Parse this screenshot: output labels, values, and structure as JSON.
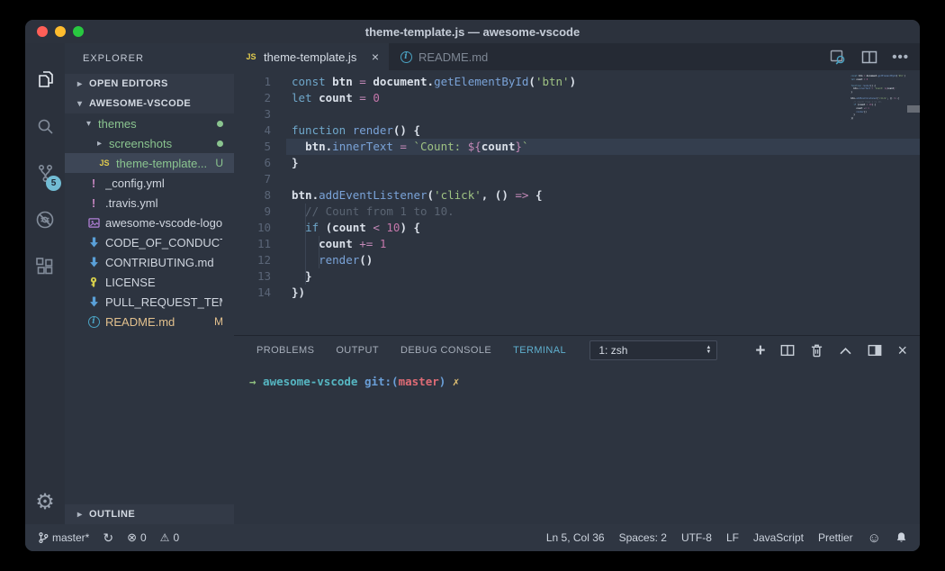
{
  "window": {
    "title": "theme-template.js — awesome-vscode"
  },
  "activity_bar": {
    "items": [
      "explorer",
      "search",
      "source-control",
      "debug",
      "extensions"
    ],
    "active": "explorer",
    "scm_badge": "5"
  },
  "sidebar": {
    "header": "EXPLORER",
    "sections": {
      "open_editors": "OPEN EDITORS",
      "root": "AWESOME-VSCODE",
      "outline": "OUTLINE"
    },
    "tree": [
      {
        "type": "folder",
        "label": "themes",
        "expanded": true,
        "color": "green",
        "badge": "dot",
        "indent": 1
      },
      {
        "type": "folder",
        "label": "screenshots",
        "expanded": false,
        "color": "green",
        "badge": "dot",
        "indent": 2
      },
      {
        "type": "file",
        "icon": "js",
        "label": "theme-template....",
        "color": "green",
        "badge": "U",
        "selected": true,
        "indent": 2
      },
      {
        "type": "file",
        "icon": "yaml",
        "label": "_config.yml",
        "indent": 1
      },
      {
        "type": "file",
        "icon": "yaml",
        "label": ".travis.yml",
        "indent": 1
      },
      {
        "type": "file",
        "icon": "image",
        "label": "awesome-vscode-logo...",
        "indent": 1
      },
      {
        "type": "file",
        "icon": "markdown",
        "label": "CODE_OF_CONDUCT....",
        "indent": 1
      },
      {
        "type": "file",
        "icon": "markdown",
        "label": "CONTRIBUTING.md",
        "indent": 1
      },
      {
        "type": "file",
        "icon": "key",
        "label": "LICENSE",
        "indent": 1
      },
      {
        "type": "file",
        "icon": "markdown",
        "label": "PULL_REQUEST_TEMP...",
        "indent": 1
      },
      {
        "type": "file",
        "icon": "info",
        "label": "README.md",
        "color": "orange",
        "badge": "M",
        "indent": 1
      }
    ]
  },
  "editor": {
    "tabs": [
      {
        "icon": "js",
        "label": "theme-template.js",
        "close": "×",
        "active": true
      },
      {
        "icon": "info",
        "label": "README.md",
        "active": false
      }
    ],
    "current_line": 5,
    "lines": [
      [
        [
          "k",
          "const "
        ],
        [
          "v",
          "btn"
        ],
        [
          "o",
          " = "
        ],
        [
          "v",
          "document"
        ],
        [
          "p",
          "."
        ],
        [
          "f",
          "getElementById"
        ],
        [
          "p",
          "("
        ],
        [
          "s",
          "'btn'"
        ],
        [
          "p",
          ")"
        ]
      ],
      [
        [
          "k",
          "let "
        ],
        [
          "v",
          "count"
        ],
        [
          "o",
          " = "
        ],
        [
          "n",
          "0"
        ]
      ],
      [],
      [
        [
          "k",
          "function "
        ],
        [
          "f",
          "render"
        ],
        [
          "p",
          "() {"
        ]
      ],
      [
        [
          "p",
          "  "
        ],
        [
          "v",
          "btn"
        ],
        [
          "p",
          "."
        ],
        [
          "f",
          "innerText"
        ],
        [
          "o",
          " = "
        ],
        [
          "s",
          "`Count: "
        ],
        [
          "o",
          "${"
        ],
        [
          "v",
          "count"
        ],
        [
          "o",
          "}"
        ],
        [
          "s",
          "`"
        ]
      ],
      [
        [
          "p",
          "}"
        ]
      ],
      [],
      [
        [
          "v",
          "btn"
        ],
        [
          "p",
          "."
        ],
        [
          "f",
          "addEventListener"
        ],
        [
          "p",
          "("
        ],
        [
          "s",
          "'click'"
        ],
        [
          "p",
          ", () "
        ],
        [
          "o",
          "=> "
        ],
        [
          "p",
          "{"
        ]
      ],
      [
        [
          "c",
          "  // Count from 1 to 10."
        ]
      ],
      [
        [
          "p",
          "  "
        ],
        [
          "k",
          "if "
        ],
        [
          "p",
          "("
        ],
        [
          "v",
          "count"
        ],
        [
          "o",
          " < "
        ],
        [
          "n",
          "10"
        ],
        [
          "p",
          ") {"
        ]
      ],
      [
        [
          "p",
          "    "
        ],
        [
          "v",
          "count"
        ],
        [
          "o",
          " += "
        ],
        [
          "n",
          "1"
        ]
      ],
      [
        [
          "p",
          "    "
        ],
        [
          "f",
          "render"
        ],
        [
          "p",
          "()"
        ]
      ],
      [
        [
          "p",
          "  }"
        ]
      ],
      [
        [
          "p",
          "})"
        ]
      ]
    ]
  },
  "panel": {
    "tabs": [
      "PROBLEMS",
      "OUTPUT",
      "DEBUG CONSOLE",
      "TERMINAL"
    ],
    "active_tab": "TERMINAL",
    "shell_select": "1: zsh"
  },
  "terminal": {
    "prompt": [
      [
        "arrow",
        "→"
      ],
      [
        "host",
        "  awesome-vscode "
      ],
      [
        "git",
        "git:("
      ],
      [
        "branch",
        "master"
      ],
      [
        "git",
        ") "
      ],
      [
        "cross",
        "✗"
      ]
    ]
  },
  "status_bar": {
    "left": [
      {
        "icon": "branch",
        "label": "master*"
      },
      {
        "icon": "sync",
        "label": ""
      },
      {
        "icon": "error",
        "label": "0"
      },
      {
        "icon": "warning",
        "label": "0"
      }
    ],
    "right": [
      {
        "label": "Ln 5, Col 36"
      },
      {
        "label": "Spaces: 2"
      },
      {
        "label": "UTF-8"
      },
      {
        "label": "LF"
      },
      {
        "label": "JavaScript"
      },
      {
        "label": "Prettier"
      },
      {
        "icon": "smiley",
        "label": ""
      },
      {
        "icon": "bell",
        "label": ""
      }
    ]
  },
  "colors": {
    "editor_bg": "#2d3440",
    "titlebar_bg": "#2c323d",
    "tabbar_bg": "#252a34",
    "statusbar_bg": "#2f3642",
    "accent_cyan": "#56b6c2",
    "git_untracked": "#8ac48f",
    "git_modified": "#e2c08d",
    "terminal_branch_red": "#de6b75",
    "js_icon_yellow": "#e3cd4e"
  }
}
